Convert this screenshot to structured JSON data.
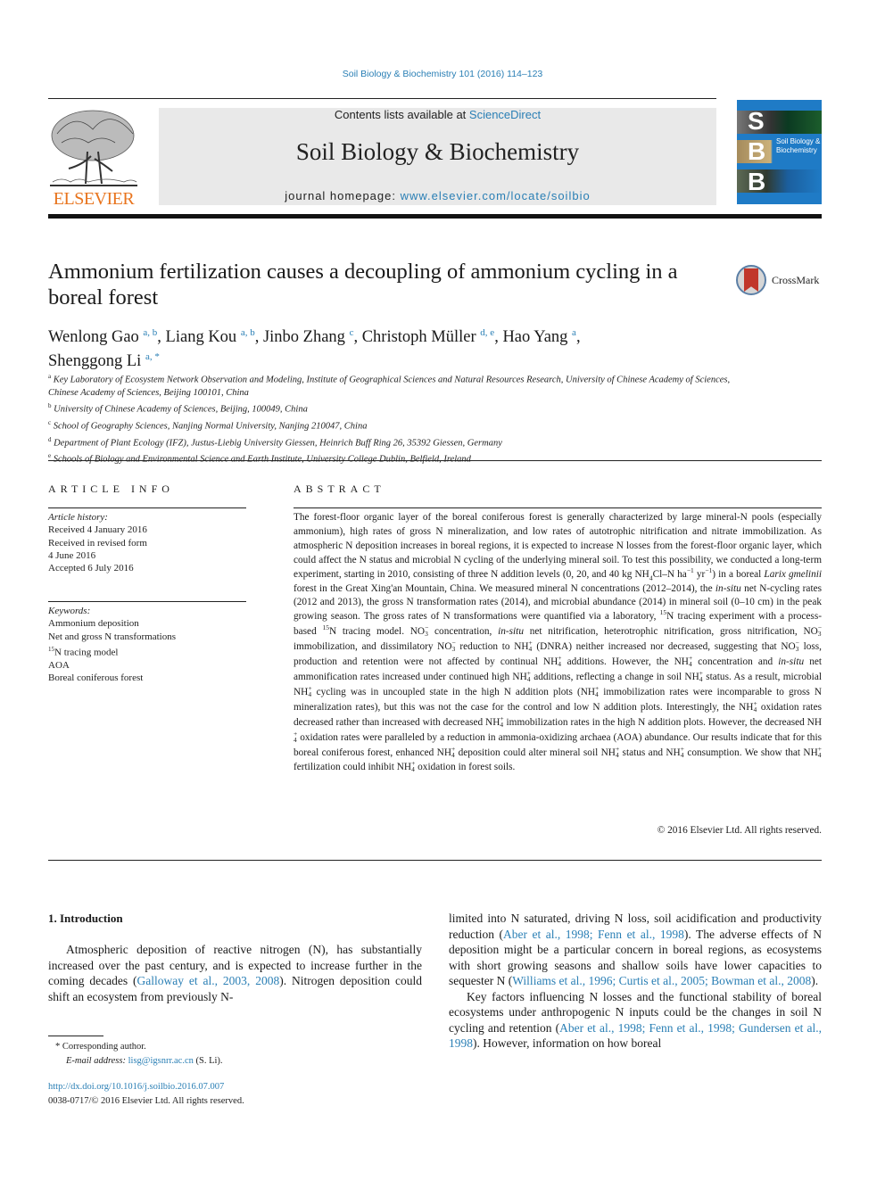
{
  "running_head": "Soil Biology & Biochemistry 101 (2016) 114–123",
  "publisher": {
    "logo_word": "ELSEVIER",
    "logo_icon": "elsevier-tree-icon"
  },
  "masthead": {
    "contents_prefix": "Contents lists available at ",
    "contents_link": "ScienceDirect",
    "journal_title": "Soil Biology & Biochemistry",
    "homepage_prefix": "journal homepage: ",
    "homepage_link": "www.elsevier.com/locate/soilbio"
  },
  "cover": {
    "letters": [
      "S",
      "B",
      "B"
    ],
    "title_line1": "Soil Biology &",
    "title_line2": "Biochemistry",
    "accent": "#1f7bc6"
  },
  "article": {
    "title": "Ammonium fertilization causes a decoupling of ammonium cycling in a boreal forest",
    "crossmark_label": "CrossMark",
    "authors": [
      {
        "name": "Wenlong Gao",
        "affil": "a, b",
        "sep": ", "
      },
      {
        "name": "Liang Kou",
        "affil": "a, b",
        "sep": ", "
      },
      {
        "name": "Jinbo Zhang",
        "affil": "c",
        "sep": ", "
      },
      {
        "name": "Christoph Müller",
        "affil": "d, e",
        "sep": ", "
      },
      {
        "name": "Hao Yang",
        "affil": "a",
        "sep": ","
      },
      {
        "name": "Shenggong Li",
        "affil": "a, *",
        "sep": ""
      }
    ],
    "affiliations": [
      {
        "key": "a",
        "text": "Key Laboratory of Ecosystem Network Observation and Modeling, Institute of Geographical Sciences and Natural Resources Research, University of Chinese Academy of Sciences, Chinese Academy of Sciences, Beijing 100101, China"
      },
      {
        "key": "b",
        "text": "University of Chinese Academy of Sciences, Beijing, 100049, China"
      },
      {
        "key": "c",
        "text": "School of Geography Sciences, Nanjing Normal University, Nanjing 210047, China"
      },
      {
        "key": "d",
        "text": "Department of Plant Ecology (IFZ), Justus-Liebig University Giessen, Heinrich Buff Ring 26, 35392 Giessen, Germany"
      },
      {
        "key": "e",
        "text": "Schools of Biology and Environmental Science and Earth Institute, University College Dublin, Belfield, Ireland"
      }
    ]
  },
  "article_info": {
    "heading": "ARTICLE INFO",
    "history_label": "Article history:",
    "history": [
      "Received 4 January 2016",
      "Received in revised form",
      "4 June 2016",
      "Accepted 6 July 2016"
    ],
    "keywords_label": "Keywords:",
    "keywords": [
      "Ammonium deposition",
      "Net and gross N transformations",
      "15N tracing model",
      "AOA",
      "Boreal coniferous forest"
    ]
  },
  "abstract": {
    "heading": "ABSTRACT",
    "copyright": "© 2016 Elsevier Ltd. All rights reserved."
  },
  "introduction": {
    "heading": "1.  Introduction",
    "left_p1_a": "Atmospheric deposition of reactive nitrogen (N), has substantially increased over the past century, and is expected to increase further in the coming decades (",
    "left_p1_cite": "Galloway et al., 2003, 2008",
    "left_p1_b": "). Nitrogen deposition could shift an ecosystem from previously N-",
    "right_p1_a": "limited into N saturated, driving N loss, soil acidification and productivity reduction (",
    "right_p1_cite1": "Aber et al., 1998; Fenn et al., 1998",
    "right_p1_b": "). The adverse effects of N deposition might be a particular concern in boreal regions, as ecosystems with short growing seasons and shallow soils have lower capacities to sequester N (",
    "right_p1_cite2": "Williams et al., 1996; Curtis et al., 2005; Bowman et al., 2008",
    "right_p1_c": ").",
    "right_p2_a": "Key factors influencing N losses and the functional stability of boreal ecosystems under anthropogenic N inputs could be the changes in soil N cycling and retention (",
    "right_p2_cite": "Aber et al., 1998; Fenn et al., 1998; Gundersen et al., 1998",
    "right_p2_b": "). However, information on how boreal"
  },
  "footnotes": {
    "corresponding": "* Corresponding author.",
    "email_label": "E-mail address:",
    "email": "lisg@igsnrr.ac.cn",
    "email_suffix": " (S. Li).",
    "doi": "http://dx.doi.org/10.1016/j.soilbio.2016.07.007",
    "issn": "0038-0717/© 2016 Elsevier Ltd. All rights reserved."
  }
}
